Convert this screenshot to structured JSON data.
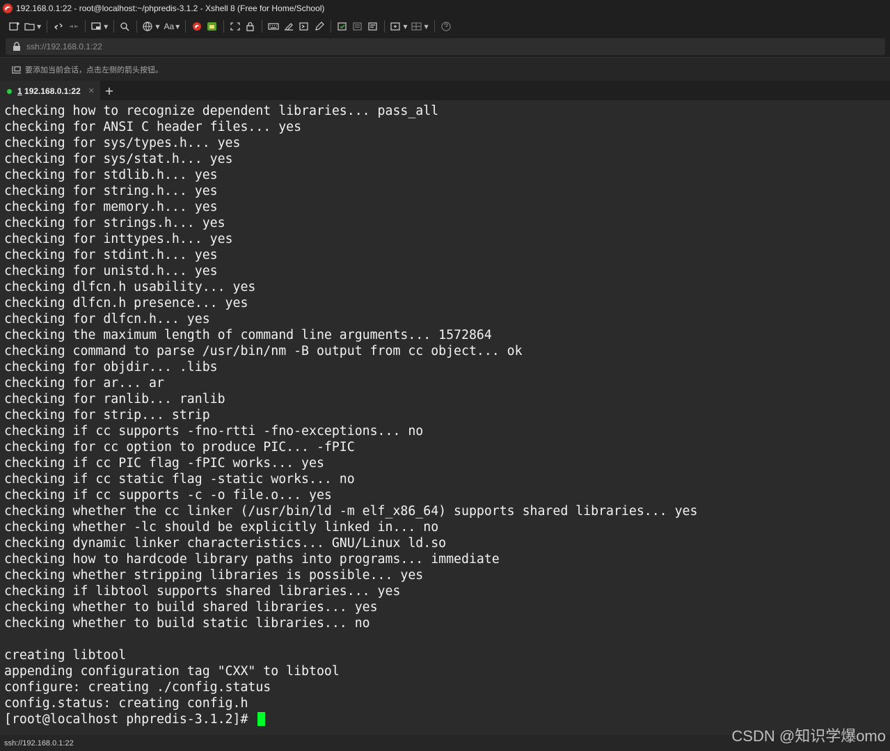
{
  "window": {
    "title": "192.168.0.1:22 - root@localhost:~/phpredis-3.1.2 - Xshell 8 (Free for Home/School)"
  },
  "toolbar": {
    "icons": [
      "new-session-icon",
      "open-folder-icon",
      "connect-icon",
      "disconnect-icon",
      "new-tab-icon",
      "search-icon",
      "globe-icon",
      "font-icon",
      "xshell-icon",
      "xftp-icon",
      "fullscreen-icon",
      "lock-icon",
      "keyboard-icon",
      "compose-icon",
      "script-icon",
      "edit-icon",
      "highlight-icon",
      "log-icon",
      "transfer-icon",
      "layout-icon",
      "layout-split-icon",
      "help-icon"
    ],
    "font_label": "Aa"
  },
  "address": {
    "value": "ssh://192.168.0.1:22"
  },
  "hint": {
    "text": "要添加当前会话，点击左侧的箭头按钮。"
  },
  "tabs": [
    {
      "index": "1",
      "label": "192.168.0.1:22",
      "status_color": "#2ecc40"
    }
  ],
  "tab_add_label": "+",
  "terminal": {
    "lines": [
      "checking how to recognize dependent libraries... pass_all",
      "checking for ANSI C header files... yes",
      "checking for sys/types.h... yes",
      "checking for sys/stat.h... yes",
      "checking for stdlib.h... yes",
      "checking for string.h... yes",
      "checking for memory.h... yes",
      "checking for strings.h... yes",
      "checking for inttypes.h... yes",
      "checking for stdint.h... yes",
      "checking for unistd.h... yes",
      "checking dlfcn.h usability... yes",
      "checking dlfcn.h presence... yes",
      "checking for dlfcn.h... yes",
      "checking the maximum length of command line arguments... 1572864",
      "checking command to parse /usr/bin/nm -B output from cc object... ok",
      "checking for objdir... .libs",
      "checking for ar... ar",
      "checking for ranlib... ranlib",
      "checking for strip... strip",
      "checking if cc supports -fno-rtti -fno-exceptions... no",
      "checking for cc option to produce PIC... -fPIC",
      "checking if cc PIC flag -fPIC works... yes",
      "checking if cc static flag -static works... no",
      "checking if cc supports -c -o file.o... yes",
      "checking whether the cc linker (/usr/bin/ld -m elf_x86_64) supports shared libraries... yes",
      "checking whether -lc should be explicitly linked in... no",
      "checking dynamic linker characteristics... GNU/Linux ld.so",
      "checking how to hardcode library paths into programs... immediate",
      "checking whether stripping libraries is possible... yes",
      "checking if libtool supports shared libraries... yes",
      "checking whether to build shared libraries... yes",
      "checking whether to build static libraries... no",
      "",
      "creating libtool",
      "appending configuration tag \"CXX\" to libtool",
      "configure: creating ./config.status",
      "config.status: creating config.h"
    ],
    "prompt": "[root@localhost phpredis-3.1.2]# ",
    "cursor_color": "#00ff2a",
    "text_color": "#f2f2f2",
    "background": "#2b2b2b"
  },
  "status": {
    "text": "ssh://192.168.0.1:22"
  },
  "watermark": {
    "text": "CSDN @知识学爆omo"
  }
}
